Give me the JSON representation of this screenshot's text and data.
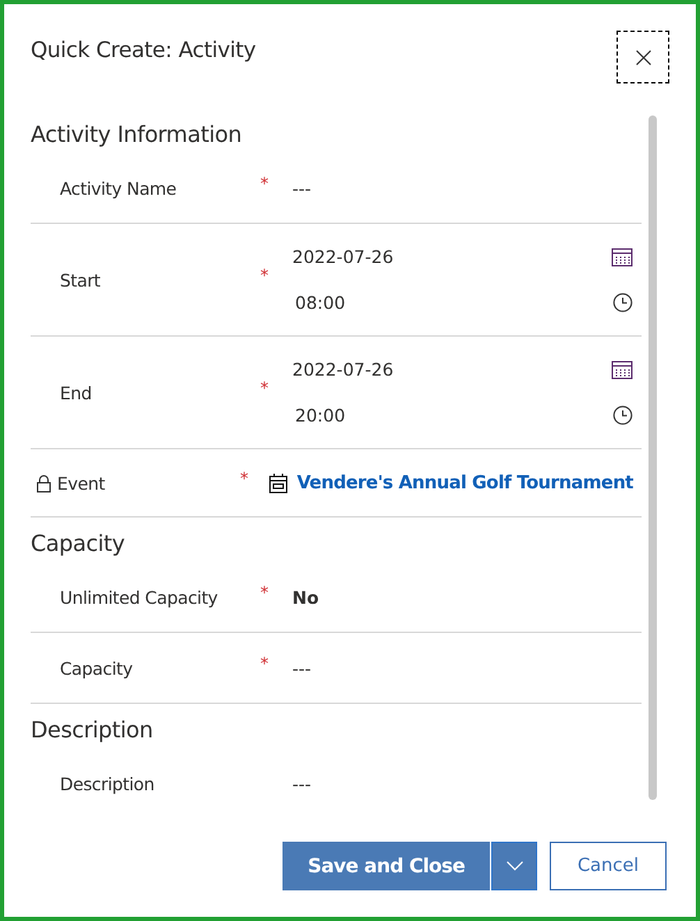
{
  "window": {
    "title": "Quick Create: Activity"
  },
  "sections": [
    {
      "heading": "Activity Information",
      "fields": [
        {
          "kind": "text",
          "label": "Activity Name",
          "required_mark": "*",
          "locked": false,
          "value": "---"
        },
        {
          "kind": "datetime",
          "label": "Start",
          "required_mark": "*",
          "locked": false,
          "date": "2022-07-26",
          "time": "08:00"
        },
        {
          "kind": "datetime",
          "label": "End",
          "required_mark": "*",
          "locked": false,
          "date": "2022-07-26",
          "time": "20:00"
        },
        {
          "kind": "lookup",
          "label": "Event",
          "required_mark": "*",
          "locked": true,
          "value": "Vendere's Annual Golf Tournament"
        }
      ]
    },
    {
      "heading": "Capacity",
      "fields": [
        {
          "kind": "choice",
          "label": "Unlimited Capacity",
          "required_mark": "*",
          "locked": false,
          "value": "No"
        },
        {
          "kind": "text",
          "label": "Capacity",
          "required_mark": "*",
          "locked": false,
          "value": "---"
        }
      ]
    },
    {
      "heading": "Description",
      "fields": [
        {
          "kind": "text",
          "label": "Description",
          "locked": false,
          "value": "---"
        }
      ]
    }
  ],
  "buttons": {
    "primary": "Save and Close",
    "secondary": "Cancel"
  }
}
